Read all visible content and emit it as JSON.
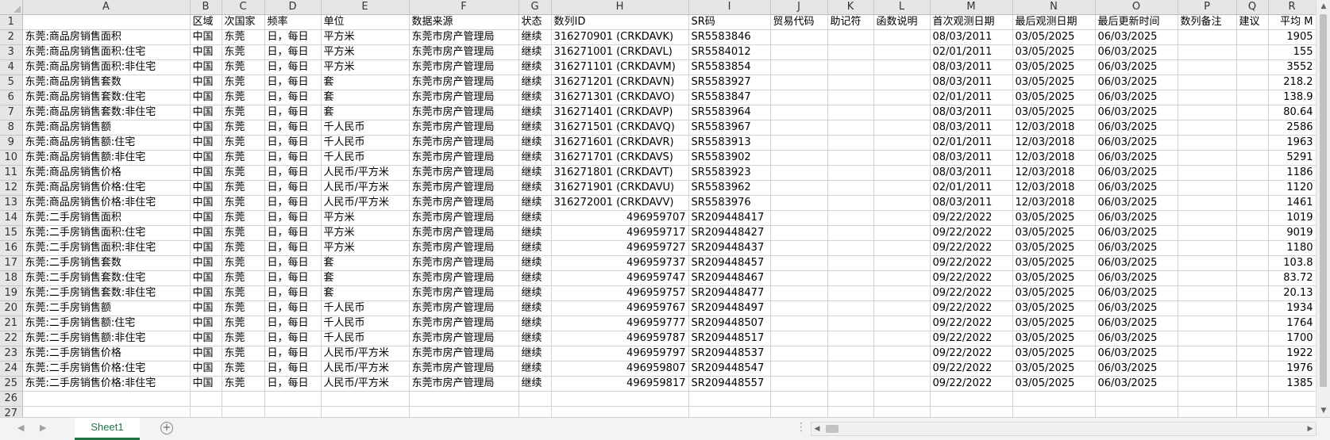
{
  "columns": [
    "A",
    "B",
    "C",
    "D",
    "E",
    "F",
    "G",
    "H",
    "I",
    "J",
    "K",
    "L",
    "M",
    "N",
    "O",
    "P",
    "Q",
    "R"
  ],
  "header": [
    "",
    "区域",
    "次国家",
    "频率",
    "单位",
    "数据来源",
    "状态",
    "数列ID",
    "SR码",
    "贸易代码",
    "助记符",
    "函数说明",
    "首次观测日期",
    "最后观测日期",
    "最后更新时间",
    "数列备注",
    "建议",
    "平均 M"
  ],
  "rows": [
    {
      "n": "2",
      "cells": [
        "东莞:商品房销售面积",
        "中国",
        "东莞",
        "日，每日",
        "平方米",
        "东莞市房产管理局",
        "继续",
        "316270901 (CRKDAVK)",
        "SR5583846",
        "",
        "",
        "",
        "08/03/2011",
        "03/05/2025",
        "06/03/2025",
        "",
        "",
        "1905"
      ]
    },
    {
      "n": "3",
      "cells": [
        "东莞:商品房销售面积:住宅",
        "中国",
        "东莞",
        "日，每日",
        "平方米",
        "东莞市房产管理局",
        "继续",
        "316271001 (CRKDAVL)",
        "SR5584012",
        "",
        "",
        "",
        "02/01/2011",
        "03/05/2025",
        "06/03/2025",
        "",
        "",
        "155"
      ]
    },
    {
      "n": "4",
      "cells": [
        "东莞:商品房销售面积:非住宅",
        "中国",
        "东莞",
        "日，每日",
        "平方米",
        "东莞市房产管理局",
        "继续",
        "316271101 (CRKDAVM)",
        "SR5583854",
        "",
        "",
        "",
        "08/03/2011",
        "03/05/2025",
        "06/03/2025",
        "",
        "",
        "3552"
      ]
    },
    {
      "n": "5",
      "cells": [
        "东莞:商品房销售套数",
        "中国",
        "东莞",
        "日，每日",
        "套",
        "东莞市房产管理局",
        "继续",
        "316271201 (CRKDAVN)",
        "SR5583927",
        "",
        "",
        "",
        "08/03/2011",
        "03/05/2025",
        "06/03/2025",
        "",
        "",
        "218.2"
      ]
    },
    {
      "n": "6",
      "cells": [
        "东莞:商品房销售套数:住宅",
        "中国",
        "东莞",
        "日，每日",
        "套",
        "东莞市房产管理局",
        "继续",
        "316271301 (CRKDAVO)",
        "SR5583847",
        "",
        "",
        "",
        "02/01/2011",
        "03/05/2025",
        "06/03/2025",
        "",
        "",
        "138.9"
      ]
    },
    {
      "n": "7",
      "cells": [
        "东莞:商品房销售套数:非住宅",
        "中国",
        "东莞",
        "日，每日",
        "套",
        "东莞市房产管理局",
        "继续",
        "316271401 (CRKDAVP)",
        "SR5583964",
        "",
        "",
        "",
        "08/03/2011",
        "03/05/2025",
        "06/03/2025",
        "",
        "",
        "80.64"
      ]
    },
    {
      "n": "8",
      "cells": [
        "东莞:商品房销售额",
        "中国",
        "东莞",
        "日，每日",
        "千人民币",
        "东莞市房产管理局",
        "继续",
        "316271501 (CRKDAVQ)",
        "SR5583967",
        "",
        "",
        "",
        "08/03/2011",
        "12/03/2018",
        "06/03/2025",
        "",
        "",
        "2586"
      ]
    },
    {
      "n": "9",
      "cells": [
        "东莞:商品房销售额:住宅",
        "中国",
        "东莞",
        "日，每日",
        "千人民币",
        "东莞市房产管理局",
        "继续",
        "316271601 (CRKDAVR)",
        "SR5583913",
        "",
        "",
        "",
        "02/01/2011",
        "12/03/2018",
        "06/03/2025",
        "",
        "",
        "1963"
      ]
    },
    {
      "n": "10",
      "cells": [
        "东莞:商品房销售额:非住宅",
        "中国",
        "东莞",
        "日，每日",
        "千人民币",
        "东莞市房产管理局",
        "继续",
        "316271701 (CRKDAVS)",
        "SR5583902",
        "",
        "",
        "",
        "08/03/2011",
        "12/03/2018",
        "06/03/2025",
        "",
        "",
        "5291"
      ]
    },
    {
      "n": "11",
      "cells": [
        "东莞:商品房销售价格",
        "中国",
        "东莞",
        "日，每日",
        "人民币/平方米",
        "东莞市房产管理局",
        "继续",
        "316271801 (CRKDAVT)",
        "SR5583923",
        "",
        "",
        "",
        "08/03/2011",
        "12/03/2018",
        "06/03/2025",
        "",
        "",
        "1186"
      ]
    },
    {
      "n": "12",
      "cells": [
        "东莞:商品房销售价格:住宅",
        "中国",
        "东莞",
        "日，每日",
        "人民币/平方米",
        "东莞市房产管理局",
        "继续",
        "316271901 (CRKDAVU)",
        "SR5583962",
        "",
        "",
        "",
        "02/01/2011",
        "12/03/2018",
        "06/03/2025",
        "",
        "",
        "1120"
      ]
    },
    {
      "n": "13",
      "cells": [
        "东莞:商品房销售价格:非住宅",
        "中国",
        "东莞",
        "日，每日",
        "人民币/平方米",
        "东莞市房产管理局",
        "继续",
        "316272001 (CRKDAVV)",
        "SR5583976",
        "",
        "",
        "",
        "08/03/2011",
        "12/03/2018",
        "06/03/2025",
        "",
        "",
        "1461"
      ]
    },
    {
      "n": "14",
      "cells": [
        "东莞:二手房销售面积",
        "中国",
        "东莞",
        "日，每日",
        "平方米",
        "东莞市房产管理局",
        "继续",
        "496959707",
        "SR209448417",
        "",
        "",
        "",
        "09/22/2022",
        "03/05/2025",
        "06/03/2025",
        "",
        "",
        "1019"
      ]
    },
    {
      "n": "15",
      "cells": [
        "东莞:二手房销售面积:住宅",
        "中国",
        "东莞",
        "日，每日",
        "平方米",
        "东莞市房产管理局",
        "继续",
        "496959717",
        "SR209448427",
        "",
        "",
        "",
        "09/22/2022",
        "03/05/2025",
        "06/03/2025",
        "",
        "",
        "9019"
      ]
    },
    {
      "n": "16",
      "cells": [
        "东莞:二手房销售面积:非住宅",
        "中国",
        "东莞",
        "日，每日",
        "平方米",
        "东莞市房产管理局",
        "继续",
        "496959727",
        "SR209448437",
        "",
        "",
        "",
        "09/22/2022",
        "03/05/2025",
        "06/03/2025",
        "",
        "",
        "1180"
      ]
    },
    {
      "n": "17",
      "cells": [
        "东莞:二手房销售套数",
        "中国",
        "东莞",
        "日，每日",
        "套",
        "东莞市房产管理局",
        "继续",
        "496959737",
        "SR209448457",
        "",
        "",
        "",
        "09/22/2022",
        "03/05/2025",
        "06/03/2025",
        "",
        "",
        "103.8"
      ]
    },
    {
      "n": "18",
      "cells": [
        "东莞:二手房销售套数:住宅",
        "中国",
        "东莞",
        "日，每日",
        "套",
        "东莞市房产管理局",
        "继续",
        "496959747",
        "SR209448467",
        "",
        "",
        "",
        "09/22/2022",
        "03/05/2025",
        "06/03/2025",
        "",
        "",
        "83.72"
      ]
    },
    {
      "n": "19",
      "cells": [
        "东莞:二手房销售套数:非住宅",
        "中国",
        "东莞",
        "日，每日",
        "套",
        "东莞市房产管理局",
        "继续",
        "496959757",
        "SR209448477",
        "",
        "",
        "",
        "09/22/2022",
        "03/05/2025",
        "06/03/2025",
        "",
        "",
        "20.13"
      ]
    },
    {
      "n": "20",
      "cells": [
        "东莞:二手房销售额",
        "中国",
        "东莞",
        "日，每日",
        "千人民币",
        "东莞市房产管理局",
        "继续",
        "496959767",
        "SR209448497",
        "",
        "",
        "",
        "09/22/2022",
        "03/05/2025",
        "06/03/2025",
        "",
        "",
        "1934"
      ]
    },
    {
      "n": "21",
      "cells": [
        "东莞:二手房销售额:住宅",
        "中国",
        "东莞",
        "日，每日",
        "千人民币",
        "东莞市房产管理局",
        "继续",
        "496959777",
        "SR209448507",
        "",
        "",
        "",
        "09/22/2022",
        "03/05/2025",
        "06/03/2025",
        "",
        "",
        "1764"
      ]
    },
    {
      "n": "22",
      "cells": [
        "东莞:二手房销售额:非住宅",
        "中国",
        "东莞",
        "日，每日",
        "千人民币",
        "东莞市房产管理局",
        "继续",
        "496959787",
        "SR209448517",
        "",
        "",
        "",
        "09/22/2022",
        "03/05/2025",
        "06/03/2025",
        "",
        "",
        "1700"
      ]
    },
    {
      "n": "23",
      "cells": [
        "东莞:二手房销售价格",
        "中国",
        "东莞",
        "日，每日",
        "人民币/平方米",
        "东莞市房产管理局",
        "继续",
        "496959797",
        "SR209448537",
        "",
        "",
        "",
        "09/22/2022",
        "03/05/2025",
        "06/03/2025",
        "",
        "",
        "1922"
      ]
    },
    {
      "n": "24",
      "cells": [
        "东莞:二手房销售价格:住宅",
        "中国",
        "东莞",
        "日，每日",
        "人民币/平方米",
        "东莞市房产管理局",
        "继续",
        "496959807",
        "SR209448547",
        "",
        "",
        "",
        "09/22/2022",
        "03/05/2025",
        "06/03/2025",
        "",
        "",
        "1976"
      ]
    },
    {
      "n": "25",
      "cells": [
        "东莞:二手房销售价格:非住宅",
        "中国",
        "东莞",
        "日，每日",
        "人民币/平方米",
        "东莞市房产管理局",
        "继续",
        "496959817",
        "SR209448557",
        "",
        "",
        "",
        "09/22/2022",
        "03/05/2025",
        "06/03/2025",
        "",
        "",
        "1385"
      ]
    }
  ],
  "empty_rows": [
    "26",
    "27"
  ],
  "header_row_label": "1",
  "sheet_tab": "Sheet1",
  "add_sheet_icon": "+",
  "tab_separator": "⋮",
  "colors": {
    "accent": "#217346",
    "header_bg": "#e6e6e6",
    "gridline": "#d4d4d4"
  }
}
